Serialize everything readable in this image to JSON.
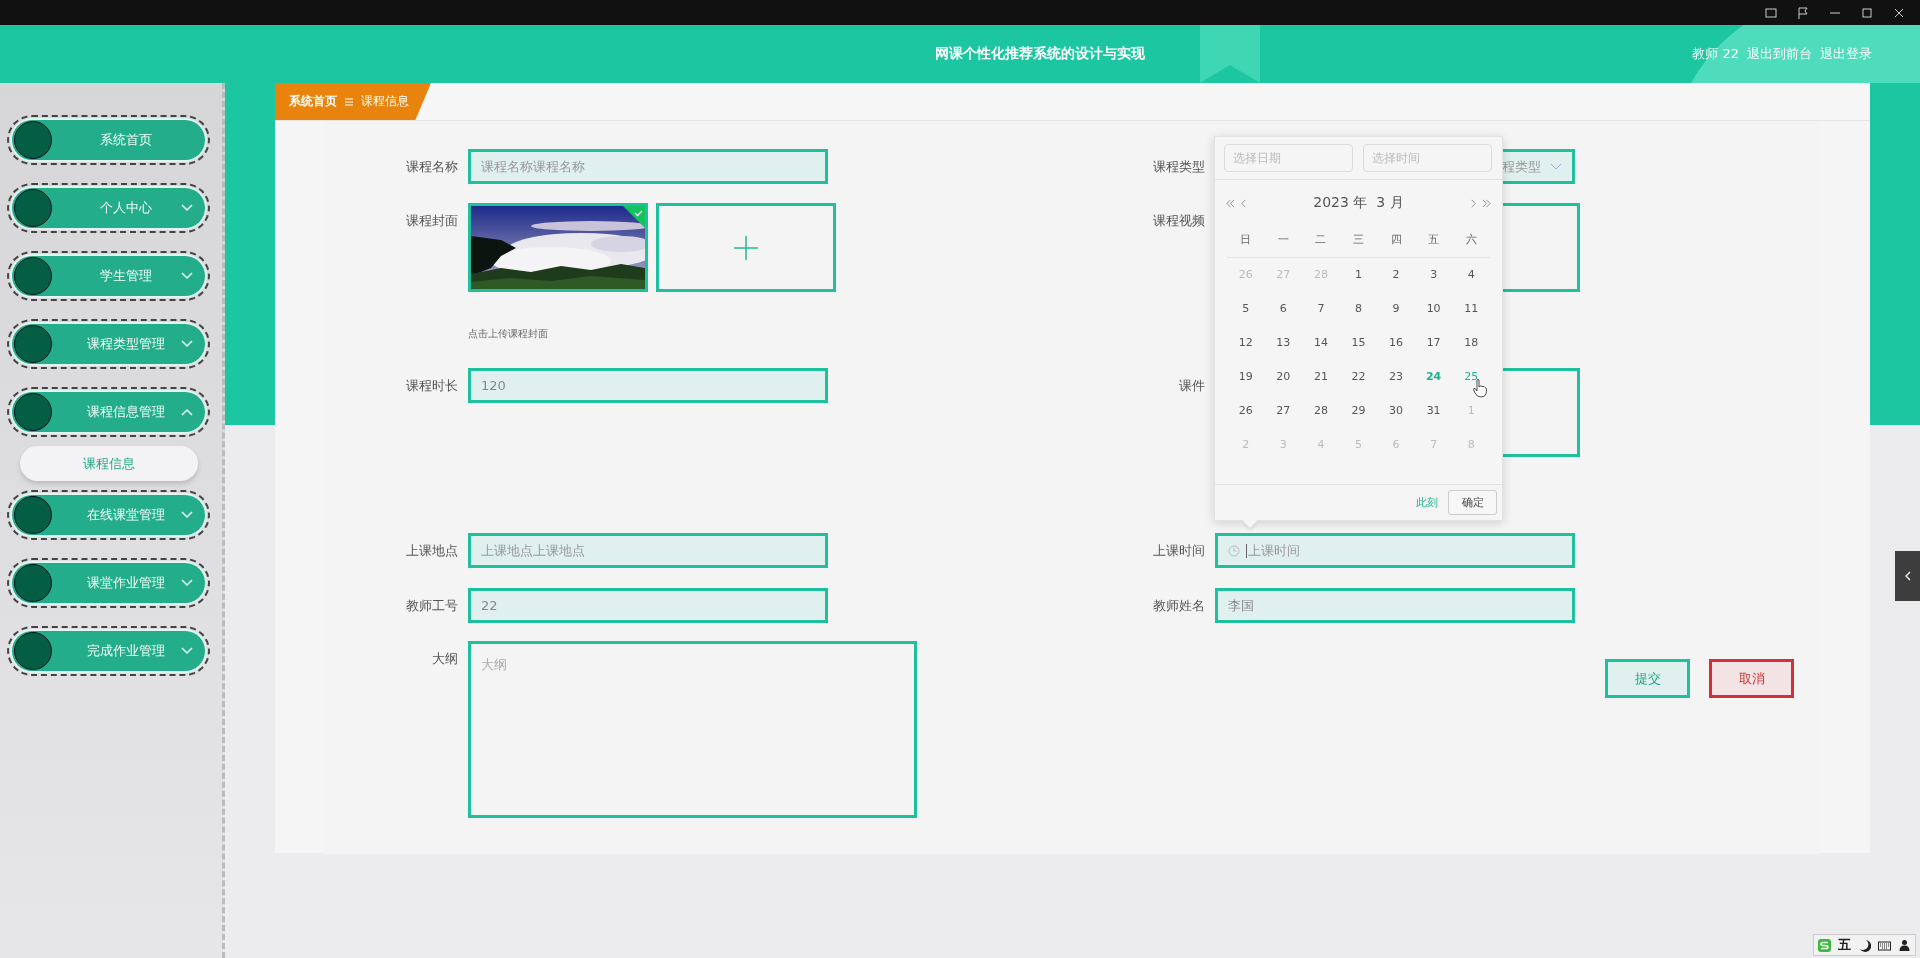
{
  "header": {
    "title": "网课个性化推荐系统的设计与实现",
    "user": "教师 22",
    "links": [
      "退出到前台",
      "退出登录"
    ]
  },
  "sidebar": {
    "items": [
      {
        "label": "系统首页",
        "kind": "link"
      },
      {
        "label": "个人中心",
        "kind": "menu",
        "expanded": false
      },
      {
        "label": "学生管理",
        "kind": "menu",
        "expanded": false
      },
      {
        "label": "课程类型管理",
        "kind": "menu",
        "expanded": false
      },
      {
        "label": "课程信息管理",
        "kind": "menu",
        "expanded": true,
        "children": [
          {
            "label": "课程信息",
            "selected": true
          }
        ]
      },
      {
        "label": "在线课堂管理",
        "kind": "menu",
        "expanded": false
      },
      {
        "label": "课堂作业管理",
        "kind": "menu",
        "expanded": false
      },
      {
        "label": "完成作业管理",
        "kind": "menu",
        "expanded": false
      }
    ]
  },
  "breadcrumb": [
    "系统首页",
    "课程信息"
  ],
  "form": {
    "fields": [
      {
        "label": "课程名称",
        "kind": "text",
        "placeholder": "课程名称课程名称"
      },
      {
        "label": "课程类型",
        "kind": "select",
        "placeholder": "程类型"
      },
      {
        "label": "课程封面",
        "kind": "image-upload",
        "files": [
          {
            "kind": "picture",
            "uploaded": true
          }
        ],
        "hint": "点击上传课程封面"
      },
      {
        "label": "课程视频",
        "kind": "file-upload"
      },
      {
        "label": "课程时长",
        "kind": "text",
        "value": "120"
      },
      {
        "label": "课件",
        "kind": "file-upload"
      },
      {
        "label": "上课地点",
        "kind": "text",
        "placeholder": "上课地点上课地点"
      },
      {
        "label": "上课时间",
        "kind": "datetime",
        "placeholder": "上课时间",
        "focused": true
      },
      {
        "label": "教师工号",
        "kind": "text",
        "value": "22"
      },
      {
        "label": "教师姓名",
        "kind": "text",
        "value": "李国"
      },
      {
        "label": "大纲",
        "kind": "textarea",
        "placeholder": "大纲"
      }
    ],
    "buttons": [
      {
        "label": "提交",
        "kind": "primary"
      },
      {
        "label": "取消",
        "kind": "danger"
      }
    ]
  },
  "date_picker": {
    "date_placeholder": "选择日期",
    "time_placeholder": "选择时间",
    "year": "2023 年",
    "month": "3 月",
    "weekdays": [
      "日",
      "一",
      "二",
      "三",
      "四",
      "五",
      "六"
    ],
    "days": [
      {
        "label": "26",
        "kind": "prev",
        "today": false,
        "hovered": false
      },
      {
        "label": "27",
        "kind": "prev",
        "today": false,
        "hovered": false
      },
      {
        "label": "28",
        "kind": "prev",
        "today": false,
        "hovered": false
      },
      {
        "label": "1",
        "kind": "current",
        "today": false,
        "hovered": false
      },
      {
        "label": "2",
        "kind": "current",
        "today": false,
        "hovered": false
      },
      {
        "label": "3",
        "kind": "current",
        "today": false,
        "hovered": false
      },
      {
        "label": "4",
        "kind": "current",
        "today": false,
        "hovered": false
      },
      {
        "label": "5",
        "kind": "current",
        "today": false,
        "hovered": false
      },
      {
        "label": "6",
        "kind": "current",
        "today": false,
        "hovered": false
      },
      {
        "label": "7",
        "kind": "current",
        "today": false,
        "hovered": false
      },
      {
        "label": "8",
        "kind": "current",
        "today": false,
        "hovered": false
      },
      {
        "label": "9",
        "kind": "current",
        "today": false,
        "hovered": false
      },
      {
        "label": "10",
        "kind": "current",
        "today": false,
        "hovered": false
      },
      {
        "label": "11",
        "kind": "current",
        "today": false,
        "hovered": false
      },
      {
        "label": "12",
        "kind": "current",
        "today": false,
        "hovered": false
      },
      {
        "label": "13",
        "kind": "current",
        "today": false,
        "hovered": false
      },
      {
        "label": "14",
        "kind": "current",
        "today": false,
        "hovered": false
      },
      {
        "label": "15",
        "kind": "current",
        "today": false,
        "hovered": false
      },
      {
        "label": "16",
        "kind": "current",
        "today": false,
        "hovered": false
      },
      {
        "label": "17",
        "kind": "current",
        "today": false,
        "hovered": false
      },
      {
        "label": "18",
        "kind": "current",
        "today": false,
        "hovered": false
      },
      {
        "label": "19",
        "kind": "current",
        "today": false,
        "hovered": false
      },
      {
        "label": "20",
        "kind": "current",
        "today": false,
        "hovered": false
      },
      {
        "label": "21",
        "kind": "current",
        "today": false,
        "hovered": false
      },
      {
        "label": "22",
        "kind": "current",
        "today": false,
        "hovered": false
      },
      {
        "label": "23",
        "kind": "current",
        "today": false,
        "hovered": false
      },
      {
        "label": "24",
        "kind": "current",
        "today": true,
        "hovered": false
      },
      {
        "label": "25",
        "kind": "current",
        "today": false,
        "hovered": true
      },
      {
        "label": "26",
        "kind": "current",
        "today": false,
        "hovered": false
      },
      {
        "label": "27",
        "kind": "current",
        "today": false,
        "hovered": false
      },
      {
        "label": "28",
        "kind": "current",
        "today": false,
        "hovered": false
      },
      {
        "label": "29",
        "kind": "current",
        "today": false,
        "hovered": false
      },
      {
        "label": "30",
        "kind": "current",
        "today": false,
        "hovered": false
      },
      {
        "label": "31",
        "kind": "current",
        "today": false,
        "hovered": false
      },
      {
        "label": "1",
        "kind": "next",
        "today": false,
        "hovered": false
      },
      {
        "label": "2",
        "kind": "next",
        "today": false,
        "hovered": false
      },
      {
        "label": "3",
        "kind": "next",
        "today": false,
        "hovered": false
      },
      {
        "label": "4",
        "kind": "next",
        "today": false,
        "hovered": false
      },
      {
        "label": "5",
        "kind": "next",
        "today": false,
        "hovered": false
      },
      {
        "label": "6",
        "kind": "next",
        "today": false,
        "hovered": false
      },
      {
        "label": "7",
        "kind": "next",
        "today": false,
        "hovered": false
      },
      {
        "label": "8",
        "kind": "next",
        "today": false,
        "hovered": false
      }
    ],
    "now_link": "此刻",
    "confirm": "确定"
  },
  "ime": {
    "mode": "五"
  }
}
